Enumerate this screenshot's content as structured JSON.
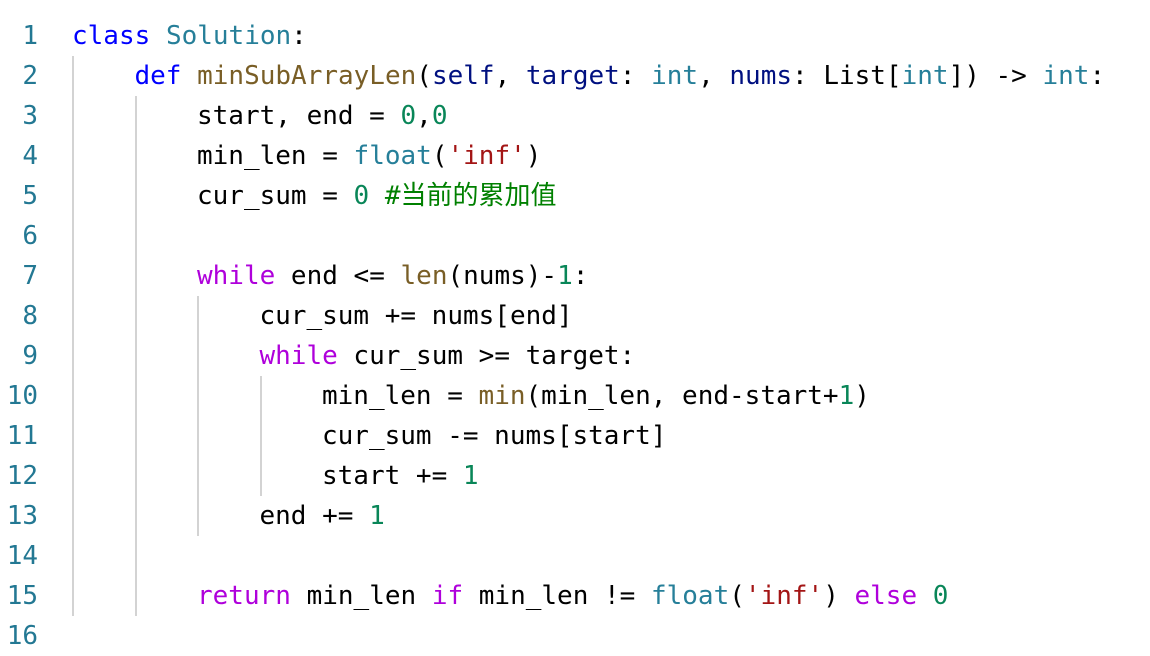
{
  "editor": {
    "language": "python",
    "colors": {
      "line_number": "#237893",
      "keyword_blue": "#0000ff",
      "keyword_purple": "#af00db",
      "class": "#267f99",
      "function": "#795e26",
      "number": "#098658",
      "string": "#a31515",
      "comment": "#008000",
      "indent_guide": "#d3d3d3"
    },
    "lines": [
      {
        "n": "1",
        "indent": 0,
        "tokens": [
          {
            "t": "class",
            "c": "kw-blue"
          },
          {
            "t": " ",
            "c": "plain"
          },
          {
            "t": "Solution",
            "c": "cls"
          },
          {
            "t": ":",
            "c": "plain"
          }
        ]
      },
      {
        "n": "2",
        "indent": 1,
        "tokens": [
          {
            "t": "def",
            "c": "kw-blue"
          },
          {
            "t": " ",
            "c": "plain"
          },
          {
            "t": "minSubArrayLen",
            "c": "fn"
          },
          {
            "t": "(",
            "c": "plain"
          },
          {
            "t": "self",
            "c": "param"
          },
          {
            "t": ", ",
            "c": "plain"
          },
          {
            "t": "target",
            "c": "param"
          },
          {
            "t": ": ",
            "c": "plain"
          },
          {
            "t": "int",
            "c": "type"
          },
          {
            "t": ", ",
            "c": "plain"
          },
          {
            "t": "nums",
            "c": "param"
          },
          {
            "t": ": List[",
            "c": "plain"
          },
          {
            "t": "int",
            "c": "type"
          },
          {
            "t": "]) -> ",
            "c": "plain"
          },
          {
            "t": "int",
            "c": "type"
          },
          {
            "t": ":",
            "c": "plain"
          }
        ]
      },
      {
        "n": "3",
        "indent": 2,
        "tokens": [
          {
            "t": "start, end = ",
            "c": "plain"
          },
          {
            "t": "0",
            "c": "num"
          },
          {
            "t": ",",
            "c": "plain"
          },
          {
            "t": "0",
            "c": "num"
          }
        ]
      },
      {
        "n": "4",
        "indent": 2,
        "tokens": [
          {
            "t": "min_len = ",
            "c": "plain"
          },
          {
            "t": "float",
            "c": "cls"
          },
          {
            "t": "(",
            "c": "plain"
          },
          {
            "t": "'inf'",
            "c": "str"
          },
          {
            "t": ")",
            "c": "plain"
          }
        ]
      },
      {
        "n": "5",
        "indent": 2,
        "tokens": [
          {
            "t": "cur_sum = ",
            "c": "plain"
          },
          {
            "t": "0",
            "c": "num"
          },
          {
            "t": " ",
            "c": "plain"
          },
          {
            "t": "#当前的累加值",
            "c": "cmt"
          }
        ]
      },
      {
        "n": "6",
        "indent": 0,
        "tokens": []
      },
      {
        "n": "7",
        "indent": 2,
        "tokens": [
          {
            "t": "while",
            "c": "kw-purple"
          },
          {
            "t": " end <= ",
            "c": "plain"
          },
          {
            "t": "len",
            "c": "fn"
          },
          {
            "t": "(nums)-",
            "c": "plain"
          },
          {
            "t": "1",
            "c": "num"
          },
          {
            "t": ":",
            "c": "plain"
          }
        ]
      },
      {
        "n": "8",
        "indent": 3,
        "tokens": [
          {
            "t": "cur_sum += nums[end]",
            "c": "plain"
          }
        ]
      },
      {
        "n": "9",
        "indent": 3,
        "tokens": [
          {
            "t": "while",
            "c": "kw-purple"
          },
          {
            "t": " cur_sum >= target:",
            "c": "plain"
          }
        ]
      },
      {
        "n": "10",
        "indent": 4,
        "tokens": [
          {
            "t": "min_len = ",
            "c": "plain"
          },
          {
            "t": "min",
            "c": "fn"
          },
          {
            "t": "(min_len, end-start+",
            "c": "plain"
          },
          {
            "t": "1",
            "c": "num"
          },
          {
            "t": ")",
            "c": "plain"
          }
        ]
      },
      {
        "n": "11",
        "indent": 4,
        "tokens": [
          {
            "t": "cur_sum -= nums[start]",
            "c": "plain"
          }
        ]
      },
      {
        "n": "12",
        "indent": 4,
        "tokens": [
          {
            "t": "start += ",
            "c": "plain"
          },
          {
            "t": "1",
            "c": "num"
          }
        ]
      },
      {
        "n": "13",
        "indent": 3,
        "tokens": [
          {
            "t": "end += ",
            "c": "plain"
          },
          {
            "t": "1",
            "c": "num"
          }
        ]
      },
      {
        "n": "14",
        "indent": 0,
        "tokens": []
      },
      {
        "n": "15",
        "indent": 2,
        "tokens": [
          {
            "t": "return",
            "c": "kw-purple"
          },
          {
            "t": " min_len ",
            "c": "plain"
          },
          {
            "t": "if",
            "c": "kw-purple"
          },
          {
            "t": " min_len != ",
            "c": "plain"
          },
          {
            "t": "float",
            "c": "cls"
          },
          {
            "t": "(",
            "c": "plain"
          },
          {
            "t": "'inf'",
            "c": "str"
          },
          {
            "t": ") ",
            "c": "plain"
          },
          {
            "t": "else",
            "c": "kw-purple"
          },
          {
            "t": " ",
            "c": "plain"
          },
          {
            "t": "0",
            "c": "num"
          }
        ]
      },
      {
        "n": "16",
        "indent": 0,
        "tokens": []
      }
    ]
  }
}
